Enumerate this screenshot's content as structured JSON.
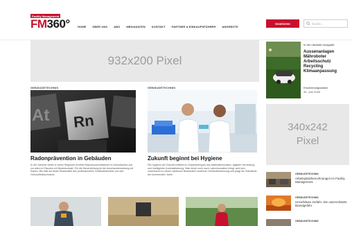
{
  "header": {
    "logo_tag": "Facility Management",
    "logo_fm": "FM",
    "logo_num": "360°",
    "nav": [
      "HOME",
      "ÜBER UNS",
      "ABO",
      "MEDIADATEN",
      "KONTAKT",
      "PARTNER & EINKAUFSFÜHRER",
      "ANGEBOTE"
    ],
    "insert_label": "Inserieren",
    "search_placeholder": "Suche..."
  },
  "banner": {
    "label": "932x200 Pixel"
  },
  "articles": [
    {
      "category": "GEBÄUDETECHNIK",
      "title": "Radonprävention in Gebäuden",
      "text": "In der Schweiz treten in vielen Regionen erhöhte Radonkonzentrationen in Innenräumen auf, vor allem in Räumen mit Bodenkontakt. Für die Neuerrichtung ist die Auseinandersetzung mit Radon. Bis halb ein fester Bestandteil des professionellen Gebäudebetriebs und des Gesundheitsschutzes.",
      "image_letters": "Rn"
    },
    {
      "category": "GEBÄUDETECHNIK",
      "title": "Zukunft beginnt bei Hygiene",
      "text": "Die Hygiene der Zukunft entsteht im Zusammenspiel aus Materialinnovation, digitaler Vernetzung und intelligenter Automatisierung. Was heute noch nach Laborinnovation klingt, wird sich zunehmend zu einem nahtlosen Bestandteil moderner Gebäudebetreuung und prägt die Standards der kommenden Jahre."
    }
  ],
  "aside_ad": {
    "label": "In der nächsten Ausgabe:",
    "title_lines": [
      "Aussenanlagen",
      "Mähroboter",
      "Arbeitsschutz",
      "Recycling",
      "Klimaanpassung"
    ],
    "date_label": "Erscheinungsdatum",
    "date": "30. Juni 2026"
  },
  "side_box": {
    "line1": "340x242",
    "line2": "Pixel"
  },
  "side_items": [
    {
      "category": "GEBÄUDETECHNIK",
      "title": "Arbeitsplatzberechnungen im Facility Management"
    },
    {
      "category": "GEBÄUDETECHNIK",
      "title": "Unsichtbare Gefahr: Die unterschätzte Brandgefahr"
    },
    {
      "category": "GEBÄUDETECHNIK",
      "title": ""
    }
  ],
  "colors": {
    "brand": "#c8102e",
    "placeholder": "#e8e8e8"
  }
}
